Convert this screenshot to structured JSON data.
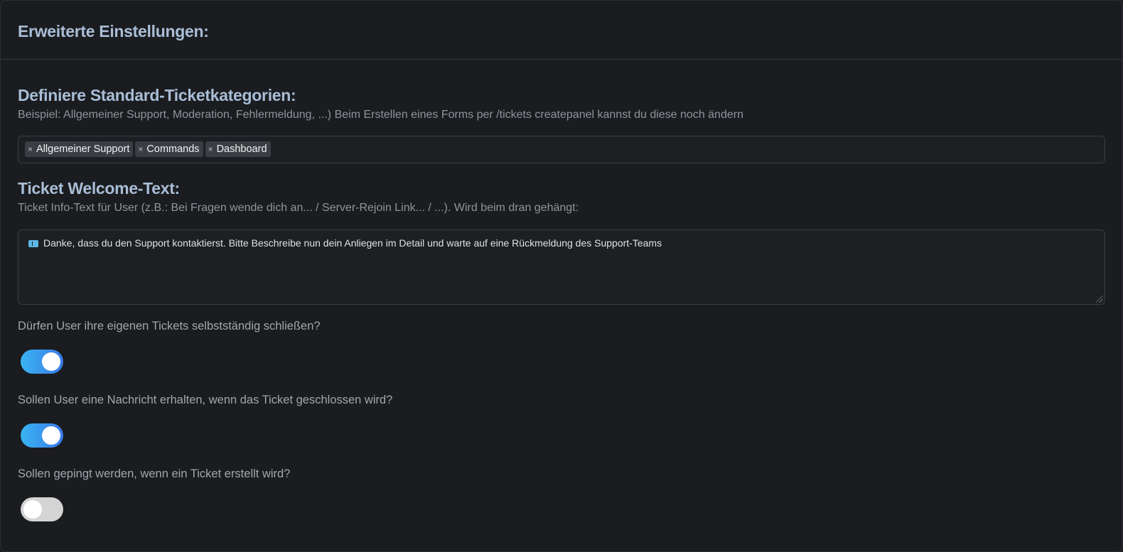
{
  "header": {
    "title": "Erweiterte Einstellungen:"
  },
  "categories": {
    "title": "Definiere Standard-Ticketkategorien:",
    "description": "Beispiel: Allgemeiner Support, Moderation, Fehlermeldung, ...) Beim Erstellen eines Forms per /tickets createpanel kannst du diese noch ändern",
    "tags": [
      "Allgemeiner Support",
      "Commands",
      "Dashboard"
    ],
    "remove_glyph": "×"
  },
  "welcome": {
    "title": "Ticket Welcome-Text:",
    "description": "Ticket Info-Text für User (z.B.: Bei Fragen wende dich an... / Server-Rejoin Link... / ...). Wird beim dran gehängt:",
    "value": "Danke, dass du den Support kontaktierst. Bitte Beschreibe nun dein Anliegen im Detail und warte auf eine Rückmeldung des Support-Teams",
    "icon": "ticket-icon"
  },
  "toggles": [
    {
      "question": "Dürfen User ihre eigenen Tickets selbstständig schließen?",
      "on": true
    },
    {
      "question": "Sollen User eine Nachricht erhalten, wenn das Ticket geschlossen wird?",
      "on": true
    },
    {
      "question": "Sollen gepingt werden, wenn ein Ticket erstellt wird?",
      "on": false
    }
  ],
  "colors": {
    "accent_start": "#3ab4f2",
    "accent_end": "#3a7ae8",
    "title": "#a9bdd6",
    "background": "#1a1c1f"
  }
}
